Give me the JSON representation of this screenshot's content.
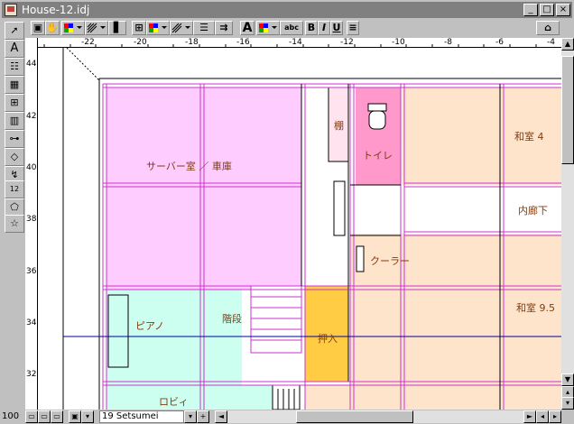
{
  "window": {
    "title": "House-12.idj",
    "minimize_label": "_",
    "maximize_label": "□",
    "close_label": "×"
  },
  "toolbar": {
    "text_tool_label": "A",
    "abc_label": "abc",
    "bold_label": "B",
    "italic_label": "I",
    "underline_label": "U"
  },
  "palette": {
    "text_tool_label": "A",
    "text_frame_label": "12"
  },
  "ruler": {
    "h_labels": [
      "-22",
      "-20",
      "-18",
      "-16",
      "-14",
      "-12",
      "-10",
      "-8",
      "-6",
      "-4"
    ],
    "v_labels": [
      "44",
      "42",
      "40",
      "38",
      "36",
      "34",
      "32"
    ]
  },
  "rooms": {
    "server_garage": "サーバー室 ／ 車庫",
    "shelf": "棚",
    "toilet": "トイレ",
    "washitsu4": "和室 4",
    "inner_corridor": "内廊下",
    "cooler": "クーラー",
    "washitsu95": "和室 9.5",
    "piano": "ピアノ",
    "stairs": "階段",
    "closet": "押入",
    "lobby": "ロビィ"
  },
  "status": {
    "zoom": "100",
    "layer": "19 Setsumei"
  },
  "colors": {
    "pink_room": "#ffccff",
    "peach_room": "#ffe4cc",
    "mint_room": "#ccfff0",
    "toilet_pink": "#ff99cc",
    "closet_yellow": "#ffcc44",
    "wall_purple": "#cc33cc",
    "grid_blue": "#000099"
  }
}
